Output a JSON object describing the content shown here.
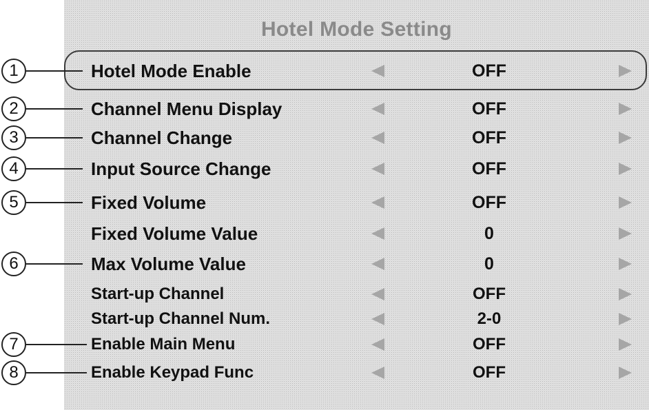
{
  "menu": {
    "title": "Hotel Mode Setting",
    "items": [
      {
        "callout": "1",
        "label": "Hotel Mode Enable",
        "value": "OFF"
      },
      {
        "callout": "2",
        "label": "Channel Menu Display",
        "value": "OFF"
      },
      {
        "callout": "3",
        "label": "Channel Change",
        "value": "OFF"
      },
      {
        "callout": "4",
        "label": "Input Source Change",
        "value": "OFF"
      },
      {
        "callout": "5",
        "label": "Fixed Volume",
        "value": "OFF"
      },
      {
        "callout": "",
        "label": "Fixed Volume Value",
        "value": "0"
      },
      {
        "callout": "6",
        "label": "Max Volume Value",
        "value": "0"
      },
      {
        "callout": "",
        "label": "Start-up Channel",
        "value": "OFF"
      },
      {
        "callout": "",
        "label": "Start-up Channel Num.",
        "value": "2-0"
      },
      {
        "callout": "7",
        "label": "Enable Main Menu",
        "value": "OFF"
      },
      {
        "callout": "8",
        "label": "Enable Keypad Func",
        "value": "OFF"
      }
    ]
  },
  "icons": {
    "decrease": "left-arrow-icon",
    "increase": "right-arrow-icon"
  },
  "colors": {
    "panel": "#e3e3e3",
    "title": "#8a8a8a",
    "text": "#111111",
    "arrow": "#a6a6a6"
  }
}
